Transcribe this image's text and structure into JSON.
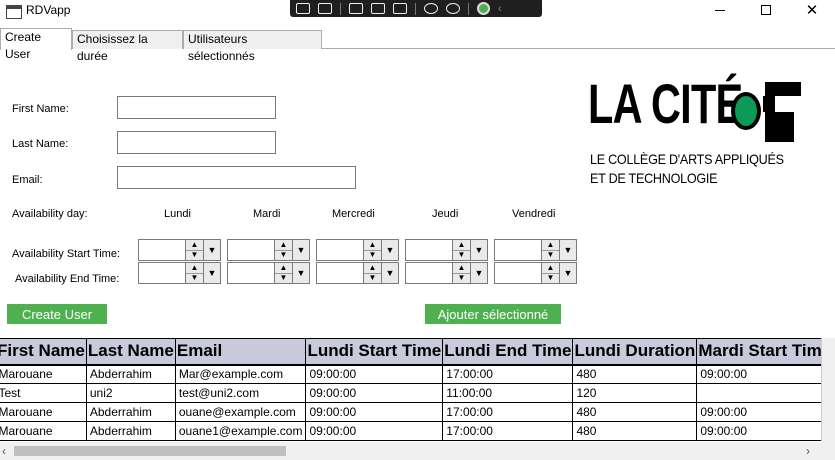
{
  "window": {
    "title": "RDVapp"
  },
  "toolbar": {
    "icons": [
      "select-icon",
      "screen-record-icon",
      "pointer-icon",
      "region-icon",
      "window-pointer-icon",
      "audio-icon",
      "accessibility-icon",
      "check-icon"
    ]
  },
  "tabs": [
    {
      "label": "Create User",
      "active": true
    },
    {
      "label": "Choisissez la durée",
      "active": false
    },
    {
      "label": "Utilisateurs sélectionnés",
      "active": false
    }
  ],
  "form": {
    "first_name_label": "First Name:",
    "last_name_label": "Last Name:",
    "email_label": "Email:",
    "first_name_value": "",
    "last_name_value": "",
    "email_value": "",
    "availability_day_label": "Availability day:",
    "start_time_label": "Availability Start Time:",
    "end_time_label": "Availability End Time:",
    "days": [
      "Lundi",
      "Mardi",
      "Mercredi",
      "Jeudi",
      "Vendredi"
    ]
  },
  "buttons": {
    "create_user": "Create User",
    "add_selected": "Ajouter sélectionné"
  },
  "logo": {
    "main": "LA CITÉ",
    "line1": "LE COLLÈGE D'ARTS APPLIQUÉS",
    "line2": "ET DE TECHNOLOGIE",
    "accent_color": "#0b9a57"
  },
  "grid": {
    "columns": [
      "First Name",
      "Last Name",
      "Email",
      "Lundi Start Time",
      "Lundi End Time",
      "Lundi Duration",
      "Mardi Start Time"
    ],
    "rows": [
      [
        "Marouane",
        "Abderrahim",
        "Mar@example.com",
        "09:00:00",
        "17:00:00",
        "480",
        "09:00:00"
      ],
      [
        "Test",
        "uni2",
        "test@uni2.com",
        "09:00:00",
        "11:00:00",
        "120",
        ""
      ],
      [
        "Marouane",
        "Abderrahim",
        "ouane@example.com",
        "09:00:00",
        "17:00:00",
        "480",
        "09:00:00"
      ],
      [
        "Marouane",
        "Abderrahim",
        "ouane1@example.com",
        "09:00:00",
        "17:00:00",
        "480",
        "09:00:00"
      ]
    ]
  },
  "colors": {
    "button_green": "#4fb04f",
    "header_bg": "#c9c9dc"
  }
}
